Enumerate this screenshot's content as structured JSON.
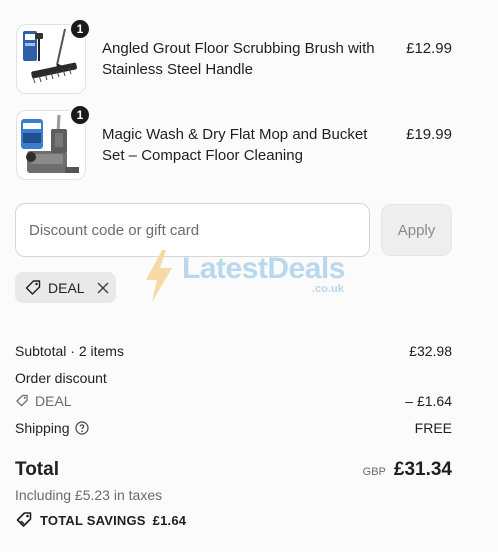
{
  "line_items": [
    {
      "name": "Angled Grout Floor Scrubbing Brush with Stainless Steel Handle",
      "price": "£12.99",
      "quantity": "1",
      "image_icon": "brush-product-icon"
    },
    {
      "name": "Magic Wash & Dry Flat Mop and Bucket Set – Compact Floor Cleaning",
      "price": "£19.99",
      "quantity": "1",
      "image_icon": "mop-bucket-product-icon"
    }
  ],
  "discount": {
    "placeholder": "Discount code or gift card",
    "value": "",
    "apply_label": "Apply",
    "applied_code": "DEAL"
  },
  "watermark": {
    "text": "LatestDeals",
    "sub": ".co.uk"
  },
  "summary": {
    "subtotal_label": "Subtotal · 2 items",
    "subtotal_value": "£32.98",
    "order_discount_label": "Order discount",
    "discount_code": "DEAL",
    "discount_value": "– £1.64",
    "shipping_label": "Shipping",
    "shipping_value": "FREE",
    "total_label": "Total",
    "currency": "GBP",
    "total_value": "£31.34",
    "taxes_note": "Including £5.23 in taxes",
    "savings_label": "TOTAL SAVINGS",
    "savings_value": "£1.64"
  }
}
